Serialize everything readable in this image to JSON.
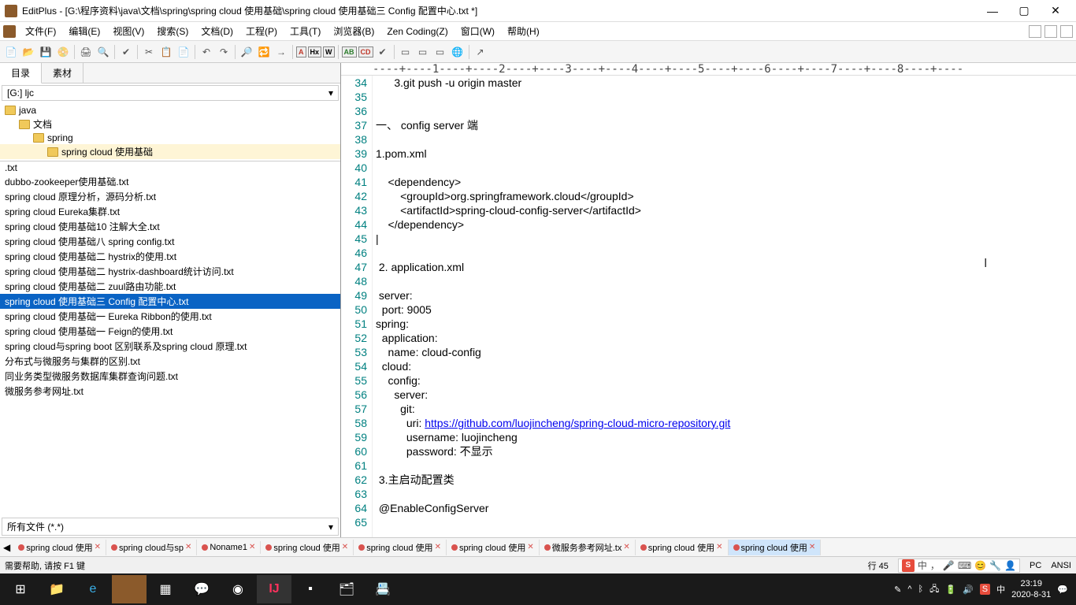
{
  "title": "EditPlus - [G:\\程序资料\\java\\文档\\spring\\spring cloud 使用基础\\spring cloud 使用基础三  Config 配置中心.txt *]",
  "menus": [
    "文件(F)",
    "编辑(E)",
    "视图(V)",
    "搜索(S)",
    "文档(D)",
    "工程(P)",
    "工具(T)",
    "浏览器(B)",
    "Zen Coding(Z)",
    "窗口(W)",
    "帮助(H)"
  ],
  "side_tabs": [
    "目录",
    "素材"
  ],
  "pathbar": "[G:] ljc",
  "tree": [
    {
      "label": "java",
      "indent": 0,
      "sel": false
    },
    {
      "label": "文档",
      "indent": 1,
      "sel": false
    },
    {
      "label": "spring",
      "indent": 2,
      "sel": false
    },
    {
      "label": "spring cloud 使用基础",
      "indent": 3,
      "sel": true
    }
  ],
  "files": [
    ".txt",
    "dubbo-zookeeper使用基础.txt",
    "spring  cloud 原理分析，源码分析.txt",
    "spring cloud  Eureka集群.txt",
    "spring cloud 使用基础10 注解大全.txt",
    "spring cloud 使用基础八 spring config.txt",
    "spring cloud 使用基础二  hystrix的使用.txt",
    "spring cloud 使用基础二 hystrix-dashboard统计访问.txt",
    "spring cloud 使用基础二 zuul路由功能.txt",
    "spring cloud 使用基础三  Config 配置中心.txt",
    "spring cloud 使用基础一 Eureka Ribbon的使用.txt",
    "spring cloud 使用基础一 Feign的使用.txt",
    "spring cloud与spring boot  区别联系及spring cloud 原理.txt",
    "分布式与微服务与集群的区别.txt",
    "同业务类型微服务数据库集群查询问题.txt",
    "微服务参考网址.txt"
  ],
  "file_selected_index": 9,
  "filter": "所有文件 (*.*)",
  "ruler": "----+----1----+----2----+----3----+----4----+----5----+----6----+----7----+----8----+----",
  "first_line": 34,
  "code_lines": [
    "      3.git push -u origin master",
    "",
    "",
    "一、 config server 端",
    "",
    "1.pom.xml",
    "",
    "    <dependency>",
    "        <groupId>org.springframework.cloud</groupId>",
    "        <artifactId>spring-cloud-config-server</artifactId>",
    "    </dependency>",
    "|",
    "",
    " 2. application.xml",
    "",
    " server:",
    "  port: 9005",
    "spring:",
    "  application:",
    "    name: cloud-config",
    "  cloud:",
    "    config:",
    "      server:",
    "        git:",
    "          uri: ",
    "          username: luojincheng",
    "          password: 不显示",
    "",
    " 3.主启动配置类",
    "",
    " @EnableConfigServer",
    ""
  ],
  "link_line_index": 24,
  "link_url": "https://github.com/luojincheng/spring-cloud-micro-repository.git",
  "open_tabs": [
    {
      "label": "spring cloud 使用",
      "mod": true
    },
    {
      "label": "spring cloud与sp",
      "mod": true
    },
    {
      "label": "Noname1",
      "mod": true
    },
    {
      "label": "spring cloud 使用",
      "mod": true
    },
    {
      "label": "spring cloud 使用",
      "mod": true
    },
    {
      "label": "spring cloud 使用",
      "mod": true
    },
    {
      "label": "微服务参考网址.tx",
      "mod": true
    },
    {
      "label": "spring cloud 使用",
      "mod": true
    },
    {
      "label": "spring cloud 使用",
      "mod": true
    }
  ],
  "active_tab_index": 8,
  "status_help": "需要帮助, 请按 F1 键",
  "status_pos": "行 45",
  "ime_items": [
    "中",
    "",
    "🎤",
    "⌨",
    "😊",
    "🔧",
    "👤"
  ],
  "status_mode": "PC",
  "status_enc": "ANSI",
  "clock_time": "23:19",
  "clock_date": "2020-8-31"
}
